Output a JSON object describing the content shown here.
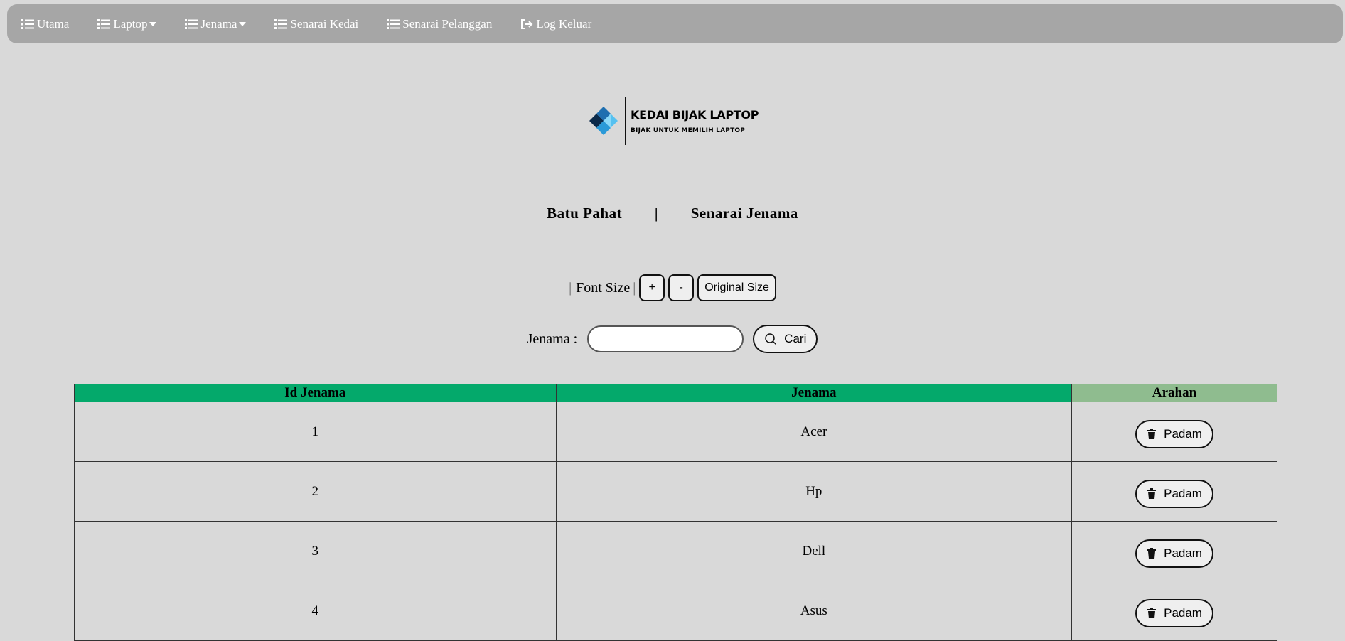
{
  "nav": [
    {
      "label": "Utama",
      "icon": "list-icon",
      "dropdown": false
    },
    {
      "label": "Laptop",
      "icon": "list-icon",
      "dropdown": true
    },
    {
      "label": "Jenama",
      "icon": "list-icon",
      "dropdown": true
    },
    {
      "label": "Senarai Kedai",
      "icon": "list-icon",
      "dropdown": false
    },
    {
      "label": "Senarai Pelanggan",
      "icon": "list-icon",
      "dropdown": false
    },
    {
      "label": "Log Keluar",
      "icon": "sign-out-icon",
      "dropdown": false
    }
  ],
  "logo": {
    "title": "KEDAI BIJAK LAPTOP",
    "subtitle": "BIJAK UNTUK MEMILIH LAPTOP"
  },
  "header": {
    "left": "Batu Pahat",
    "sep": "|",
    "right": "Senarai Jenama"
  },
  "font_controls": {
    "label": "Font Size",
    "increase": "+",
    "decrease": "-",
    "reset": "Original Size"
  },
  "search": {
    "label": "Jenama :",
    "value": "",
    "button": "Cari"
  },
  "table": {
    "headers": [
      "Id Jenama",
      "Jenama",
      "Arahan"
    ],
    "rows": [
      {
        "id": "1",
        "name": "Acer",
        "action": "Padam"
      },
      {
        "id": "2",
        "name": "Hp",
        "action": "Padam"
      },
      {
        "id": "3",
        "name": "Dell",
        "action": "Padam"
      },
      {
        "id": "4",
        "name": "Asus",
        "action": "Padam"
      }
    ]
  },
  "colors": {
    "navbar": "#a6a6a6",
    "header_green": "#04a96b",
    "header_arahan": "#8fbc8f",
    "background": "#d9d9d9"
  }
}
